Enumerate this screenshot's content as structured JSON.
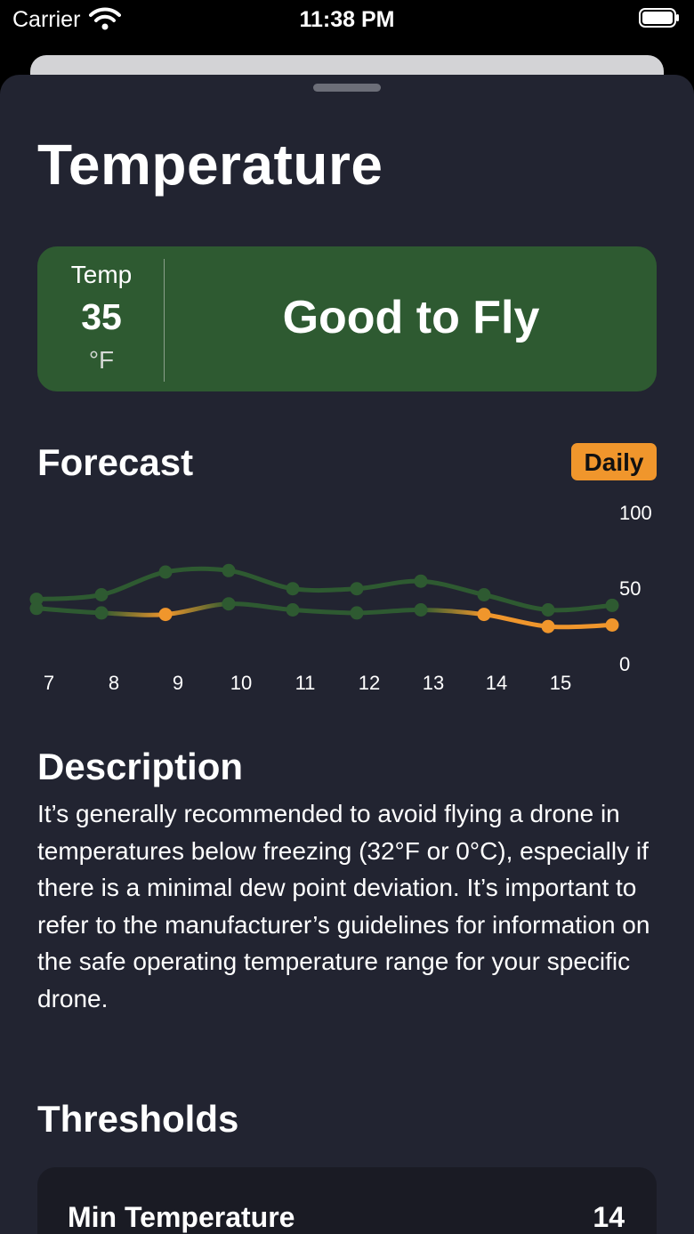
{
  "status_bar": {
    "carrier": "Carrier",
    "time": "11:38 PM"
  },
  "page": {
    "title": "Temperature"
  },
  "status_card": {
    "temp_label": "Temp",
    "temp_value": "35",
    "temp_unit": "°F",
    "status": "Good to Fly",
    "color": "#2e5a31"
  },
  "forecast": {
    "title": "Forecast",
    "toggle_label": "Daily",
    "toggle_color": "#f0962c"
  },
  "chart_data": {
    "type": "line",
    "x": [
      "7",
      "8",
      "9",
      "10",
      "11",
      "12",
      "13",
      "14",
      "15",
      ""
    ],
    "ylim": [
      0,
      100
    ],
    "yticks": [
      "100",
      "50",
      "0"
    ],
    "series": [
      {
        "values": [
          42,
          45,
          60,
          61,
          49,
          49,
          54,
          45,
          35,
          38
        ],
        "color": "#2e5a31"
      },
      {
        "values": [
          36,
          33,
          32,
          39,
          35,
          33,
          35,
          32,
          24,
          25
        ],
        "colors": [
          "#2e5a31",
          "#2e5a31",
          "#f0962c",
          "#2e5a31",
          "#2e5a31",
          "#2e5a31",
          "#2e5a31",
          "#f0962c",
          "#f0962c",
          "#f0962c"
        ]
      }
    ]
  },
  "description": {
    "title": "Description",
    "text": "It’s generally recommended to avoid flying a drone in temperatures below freezing (32°F or 0°C), especially if there is a minimal dew point deviation. It’s important to refer to the manufacturer’s guidelines for information on the safe operating temperature range for your specific drone."
  },
  "thresholds": {
    "title": "Thresholds",
    "items": [
      {
        "label": "Min Temperature",
        "value": "14"
      }
    ]
  }
}
